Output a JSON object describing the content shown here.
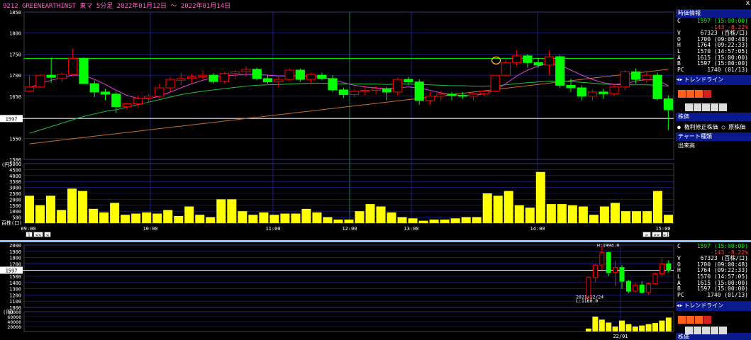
{
  "title": {
    "text": "9212 GREENEARTHINST 東マ 5分足 2022年01月12日 ～ 2022年01月14日",
    "close": "x"
  },
  "colors": {
    "up": "#ff0000",
    "down": "#00ff00",
    "vol": "#ffff00",
    "grid": "#2a2aa0",
    "hline_green": "#00ff00",
    "hline_white": "#d0d0ff",
    "ma_short": "#e040e0",
    "ma_mid": "#20c040",
    "ma_long": "#c07030"
  },
  "main_chart": {
    "type": "candlestick",
    "ylim": [
      1500,
      1850
    ],
    "y_ticks": [
      "1850",
      "1800",
      "1750",
      "1700",
      "1650",
      "1600",
      "1550",
      "1500"
    ],
    "current_price_label": "1597",
    "hline_values": [
      1740,
      1597
    ],
    "x_tick_labels": [
      "09:00",
      "10:00",
      "11:00",
      "12:00",
      "13:00",
      "14:00",
      "15:00"
    ],
    "candles": [
      [
        1662,
        1700,
        1660,
        1672
      ],
      [
        1672,
        1702,
        1670,
        1700
      ],
      [
        1700,
        1740,
        1682,
        1695
      ],
      [
        1692,
        1706,
        1684,
        1702
      ],
      [
        1702,
        1763,
        1698,
        1740
      ],
      [
        1740,
        1742,
        1680,
        1680
      ],
      [
        1680,
        1688,
        1648,
        1660
      ],
      [
        1660,
        1668,
        1640,
        1655
      ],
      [
        1655,
        1660,
        1610,
        1625
      ],
      [
        1625,
        1635,
        1618,
        1632
      ],
      [
        1632,
        1650,
        1625,
        1645
      ],
      [
        1645,
        1655,
        1635,
        1650
      ],
      [
        1650,
        1680,
        1646,
        1670
      ],
      [
        1670,
        1696,
        1660,
        1690
      ],
      [
        1688,
        1706,
        1676,
        1692
      ],
      [
        1692,
        1704,
        1680,
        1696
      ],
      [
        1696,
        1712,
        1688,
        1700
      ],
      [
        1700,
        1705,
        1680,
        1685
      ],
      [
        1685,
        1708,
        1680,
        1704
      ],
      [
        1704,
        1712,
        1690,
        1708
      ],
      [
        1708,
        1722,
        1696,
        1714
      ],
      [
        1714,
        1718,
        1688,
        1692
      ],
      [
        1692,
        1700,
        1680,
        1684
      ],
      [
        1684,
        1696,
        1672,
        1690
      ],
      [
        1690,
        1716,
        1686,
        1712
      ],
      [
        1712,
        1716,
        1684,
        1690
      ],
      [
        1690,
        1706,
        1680,
        1702
      ],
      [
        1700,
        1706,
        1688,
        1692
      ],
      [
        1692,
        1700,
        1660,
        1665
      ],
      [
        1665,
        1670,
        1646,
        1654
      ],
      [
        1654,
        1666,
        1648,
        1662
      ],
      [
        1662,
        1674,
        1652,
        1664
      ],
      [
        1664,
        1674,
        1655,
        1668
      ],
      [
        1668,
        1672,
        1640,
        1660
      ],
      [
        1660,
        1694,
        1652,
        1690
      ],
      [
        1690,
        1696,
        1676,
        1684
      ],
      [
        1684,
        1690,
        1630,
        1640
      ],
      [
        1640,
        1660,
        1630,
        1650
      ],
      [
        1650,
        1664,
        1640,
        1655
      ],
      [
        1655,
        1660,
        1640,
        1652
      ],
      [
        1652,
        1660,
        1644,
        1650
      ],
      [
        1650,
        1660,
        1640,
        1656
      ],
      [
        1656,
        1664,
        1650,
        1662
      ],
      [
        1662,
        1700,
        1660,
        1700
      ],
      [
        1700,
        1742,
        1698,
        1730
      ],
      [
        1730,
        1760,
        1722,
        1746
      ],
      [
        1746,
        1750,
        1718,
        1730
      ],
      [
        1730,
        1740,
        1718,
        1724
      ],
      [
        1724,
        1760,
        1700,
        1744
      ],
      [
        1744,
        1748,
        1670,
        1676
      ],
      [
        1676,
        1692,
        1660,
        1670
      ],
      [
        1670,
        1676,
        1640,
        1650
      ],
      [
        1650,
        1666,
        1640,
        1660
      ],
      [
        1660,
        1668,
        1644,
        1656
      ],
      [
        1656,
        1680,
        1650,
        1672
      ],
      [
        1672,
        1712,
        1664,
        1708
      ],
      [
        1708,
        1716,
        1680,
        1690
      ],
      [
        1690,
        1708,
        1682,
        1700
      ],
      [
        1700,
        1706,
        1640,
        1644
      ],
      [
        1644,
        1652,
        1570,
        1618
      ]
    ],
    "ma_short": [
      1670,
      1680,
      1688,
      1694,
      1700,
      1700,
      1690,
      1678,
      1664,
      1652,
      1645,
      1644,
      1650,
      1660,
      1670,
      1680,
      1688,
      1694,
      1698,
      1700,
      1702,
      1702,
      1700,
      1698,
      1698,
      1698,
      1698,
      1696,
      1690,
      1682,
      1676,
      1672,
      1670,
      1668,
      1670,
      1672,
      1670,
      1664,
      1658,
      1654,
      1652,
      1652,
      1656,
      1664,
      1680,
      1698,
      1712,
      1722,
      1728,
      1724,
      1712,
      1700,
      1690,
      1682,
      1678,
      1680,
      1686,
      1690,
      1688,
      1675
    ],
    "ma_mid": [
      1562,
      1570,
      1578,
      1586,
      1594,
      1602,
      1608,
      1614,
      1618,
      1624,
      1630,
      1636,
      1642,
      1648,
      1654,
      1658,
      1662,
      1665,
      1668,
      1671,
      1674,
      1676,
      1677,
      1678,
      1679,
      1680,
      1681,
      1681,
      1680,
      1679,
      1679,
      1679,
      1679,
      1678,
      1679,
      1679,
      1678,
      1677,
      1676,
      1675,
      1675,
      1674,
      1674,
      1675,
      1677,
      1680,
      1682,
      1684,
      1686,
      1686,
      1685,
      1683,
      1681,
      1679,
      1678,
      1677,
      1677,
      1677,
      1676,
      1674
    ],
    "ma_long": [
      1537,
      1540,
      1543,
      1546,
      1549,
      1552,
      1555,
      1558,
      1561,
      1564,
      1567,
      1570,
      1573,
      1576,
      1579,
      1582,
      1585,
      1588,
      1591,
      1594,
      1597,
      1600,
      1603,
      1606,
      1609,
      1612,
      1615,
      1618,
      1621,
      1624,
      1627,
      1630,
      1633,
      1636,
      1639,
      1642,
      1645,
      1648,
      1651,
      1654,
      1657,
      1660,
      1663,
      1666,
      1669,
      1672,
      1675,
      1678,
      1681,
      1684,
      1687,
      1690,
      1693,
      1696,
      1699,
      1702,
      1705,
      1708,
      1711,
      1714
    ]
  },
  "volume_chart": {
    "type": "bar",
    "unit": "(円)",
    "unit2": "百株(口)",
    "y_ticks": [
      "5000",
      "4500",
      "4000",
      "3500",
      "3000",
      "2500",
      "2000",
      "1500",
      "1000",
      "500"
    ],
    "ylim": [
      0,
      5000
    ],
    "values": [
      2300,
      1500,
      2300,
      1100,
      2900,
      2700,
      1200,
      900,
      1700,
      700,
      800,
      900,
      800,
      1100,
      600,
      1400,
      700,
      500,
      2000,
      2000,
      1000,
      700,
      900,
      700,
      800,
      800,
      1200,
      900,
      500,
      300,
      300,
      1000,
      1600,
      1400,
      900,
      500,
      400,
      200,
      300,
      300,
      400,
      500,
      500,
      2500,
      2300,
      2700,
      1500,
      1300,
      4300,
      1600,
      1600,
      1500,
      1400,
      700,
      1400,
      1700,
      1000,
      1000,
      1000,
      2700,
      700
    ]
  },
  "nav_buttons": {
    "first": "|<",
    "prev_page": "<<",
    "prev": "<",
    "next": ">",
    "next_page": ">>",
    "last": ">|"
  },
  "sub_chart": {
    "type": "candlestick",
    "ylim": [
      1000,
      2000
    ],
    "y_ticks": [
      "2000",
      "1900",
      "1800",
      "1700",
      "1600",
      "1500",
      "1400",
      "1300",
      "1200",
      "1100",
      "1000"
    ],
    "unit": "(円)",
    "current_price_label": "1597",
    "high_annotation": "H:1994.0",
    "low_date": "2021/12/24",
    "low_annotation": "L:1160.0",
    "x_tick_label": "22/01",
    "candles": [
      [
        1150,
        1500,
        1150,
        1480
      ],
      [
        1480,
        1700,
        1400,
        1680
      ],
      [
        1680,
        1994,
        1600,
        1880
      ],
      [
        1880,
        1900,
        1500,
        1560
      ],
      [
        1560,
        1750,
        1340,
        1640
      ],
      [
        1640,
        1680,
        1300,
        1420
      ],
      [
        1420,
        1440,
        1230,
        1260
      ],
      [
        1260,
        1400,
        1240,
        1360
      ],
      [
        1360,
        1420,
        1220,
        1240
      ],
      [
        1240,
        1400,
        1200,
        1380
      ],
      [
        1380,
        1560,
        1360,
        1540
      ],
      [
        1540,
        1800,
        1500,
        1700
      ],
      [
        1700,
        1760,
        1560,
        1597
      ]
    ],
    "vol_ticks": [
      "80000",
      "60000",
      "40000",
      "20000"
    ],
    "vol_values": [
      12000,
      60000,
      48000,
      36000,
      20000,
      44000,
      30000,
      20000,
      24000,
      30000,
      34000,
      44000,
      56000
    ]
  },
  "side_panel": {
    "info_title": "時価情報",
    "rows": [
      {
        "k": "C",
        "v": "1597 (15:00:00)",
        "c": "#00ff00"
      },
      {
        "k": "",
        "v": "-143 -8.22%",
        "c": "#ff4444"
      },
      {
        "k": "V",
        "v": "67323 (百株/口)",
        "c": "#ffffff"
      },
      {
        "k": "O",
        "v": "1700 (09:00:48)",
        "c": "#ffffff"
      },
      {
        "k": "H",
        "v": "1764 (09:22:33)",
        "c": "#ffffff"
      },
      {
        "k": "L",
        "v": "1570 (14:57:05)",
        "c": "#ffffff"
      },
      {
        "k": "A",
        "v": "1615 (15:00:00)",
        "c": "#ffffff"
      },
      {
        "k": "B",
        "v": "1597 (15:00:00)",
        "c": "#ffffff"
      },
      {
        "k": "PC",
        "v": "1740 (01/13)",
        "c": "#ffffff"
      }
    ],
    "trendline": "トレンドライン",
    "kabuka_title": "株価",
    "radio_adjusted": "権利修正株価",
    "radio_raw": "原株価",
    "chart_type_title": "チャート種類",
    "chart_type_value": "出来高",
    "rows2": [
      {
        "k": "C",
        "v": "1597 (15:00:00)",
        "c": "#00ff00"
      },
      {
        "k": "",
        "v": "-143 -8.22%",
        "c": "#ff4444"
      },
      {
        "k": "V",
        "v": "67323 (百株/口)",
        "c": "#ffffff"
      },
      {
        "k": "O",
        "v": "1700 (09:00:48)",
        "c": "#ffffff"
      },
      {
        "k": "H",
        "v": "1764 (09:22:33)",
        "c": "#ffffff"
      },
      {
        "k": "L",
        "v": "1570 (14:57:05)",
        "c": "#ffffff"
      },
      {
        "k": "A",
        "v": "1615 (15:00:00)",
        "c": "#ffffff"
      },
      {
        "k": "B",
        "v": "1597 (15:00:00)",
        "c": "#ffffff"
      },
      {
        "k": "PC",
        "v": "1740 (01/13)",
        "c": "#ffffff"
      }
    ],
    "kabuka_title2": "株価"
  }
}
